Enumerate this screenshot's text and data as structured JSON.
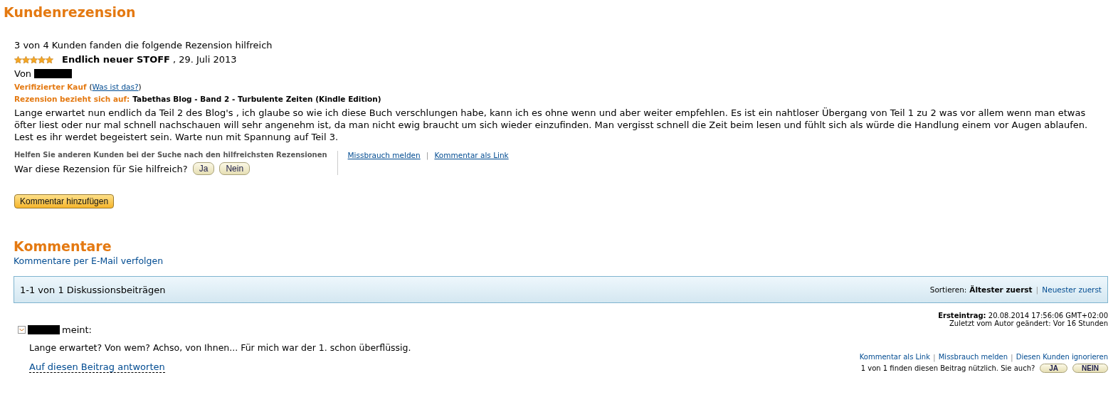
{
  "page_title": "Kundenrezension",
  "review": {
    "helpful_summary": "3 von 4 Kunden fanden die folgende Rezension hilfreich",
    "stars": 5,
    "title": "Endlich neuer STOFF",
    "date": ", 29. Juli 2013",
    "author_prefix": "Von",
    "verified_label": "Verifizierter Kauf",
    "paren_open": "(",
    "verified_link": "Was ist das?",
    "paren_close": ")",
    "refers_label": "Rezension bezieht sich auf:",
    "refers_product": "Tabethas Blog - Band 2 - Turbulente Zeiten (Kindle Edition)",
    "body": "Lange erwartet nun endlich da Teil 2 des Blog's , ich glaube so wie ich diese Buch verschlungen habe, kann ich es ohne wenn und aber weiter empfehlen. Es ist ein nahtloser Übergang von Teil 1 zu 2 was vor allem wenn man etwas öfter liest oder nur mal schnell nachschauen will sehr angenehm ist, da man nicht ewig braucht um sich wieder einzufinden. Man vergisst schnell die Zeit beim lesen und fühlt sich als würde die Handlung einem vor Augen ablaufen. Lest es ihr werdet begeistert sein. Warte nun mit Spannung auf Teil 3.",
    "vote_hint": "Helfen Sie anderen Kunden bei der Suche nach den hilfreichsten Rezensionen",
    "vote_question": "War diese Rezension für Sie hilfreich?",
    "vote_buttons": [
      "Ja",
      "Nein"
    ],
    "links": [
      "Missbrauch melden",
      "Kommentar als Link"
    ],
    "link_separators": [
      "|"
    ],
    "add_comment_button": "Kommentar hinzufügen"
  },
  "comments": {
    "heading": "Kommentare",
    "follow_link": "Kommentare per E-Mail verfolgen",
    "count": "1-1 von 1 Diskussionsbeiträgen",
    "sort_label": "Sortieren:",
    "sort_separators": [
      "|"
    ],
    "sort_options": [
      {
        "label": "Ältester zuerst",
        "selected": true
      },
      {
        "label": "Neuester zuerst",
        "selected": false
      }
    ],
    "posts": [
      {
        "posted_label": "Ersteintrag:",
        "posted": "20.08.2014 17:56:06 GMT+02:00",
        "edited": "Zuletzt vom Autor geändert: Vor 16 Stunden",
        "says": "meint:",
        "text": "Lange erwartet? Von wem? Achso, von Ihnen... Für mich war der 1. schon überflüssig.",
        "reply_link": "Auf diesen Beitrag antworten",
        "links": [
          "Kommentar als Link",
          "Missbrauch melden",
          "Diesen Kunden ignorieren"
        ],
        "link_separators": [
          "|",
          "|"
        ],
        "helpful": "1 von 1 finden diesen Beitrag nützlich. Sie auch?",
        "vote_buttons": [
          "JA",
          "NEIN"
        ]
      }
    ]
  }
}
